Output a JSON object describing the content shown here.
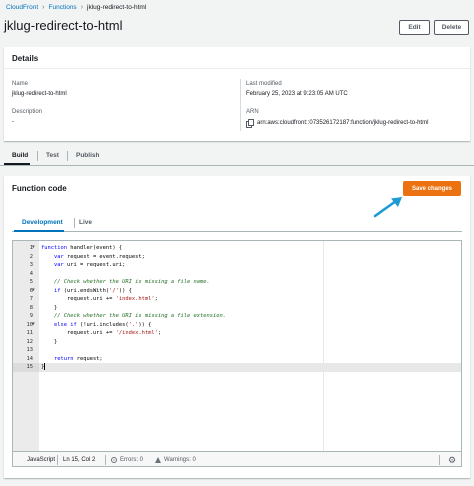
{
  "breadcrumb": {
    "items": [
      "CloudFront",
      "Functions",
      "jklug-redirect-to-html"
    ]
  },
  "page_title": "jklug-redirect-to-html",
  "header_buttons": {
    "edit": "Edit",
    "delete": "Delete"
  },
  "details": {
    "title": "Details",
    "name_label": "Name",
    "name_value": "jklug-redirect-to-html",
    "description_label": "Description",
    "description_value": "-",
    "last_modified_label": "Last modified",
    "last_modified_value": "February 25, 2023 at 9:23:05 AM UTC",
    "arn_label": "ARN",
    "arn_value": "arn:aws:cloudfront::073526172187:function/jklug-redirect-to-html"
  },
  "tabs": [
    "Build",
    "Test",
    "Publish"
  ],
  "function_code": {
    "title": "Function code",
    "save_label": "Save changes",
    "subtabs": [
      "Development",
      "Live"
    ]
  },
  "editor": {
    "lines": [
      {
        "n": "1",
        "fold": true,
        "html": "<span class='kw'>function</span> handler(event) {"
      },
      {
        "n": "2",
        "fold": false,
        "html": "    <span class='kw'>var</span> request = event.request;"
      },
      {
        "n": "3",
        "fold": false,
        "html": "    <span class='kw'>var</span> uri = request.uri;"
      },
      {
        "n": "4",
        "fold": false,
        "html": ""
      },
      {
        "n": "5",
        "fold": false,
        "html": "    <span class='cm'>// Check whether the URI is missing a file name.</span>"
      },
      {
        "n": "6",
        "fold": true,
        "html": "    <span class='kw'>if</span> (uri.endsWith(<span class='str'>'/'</span>)) {"
      },
      {
        "n": "7",
        "fold": false,
        "html": "        request.uri += <span class='str'>'index.html'</span>;"
      },
      {
        "n": "8",
        "fold": false,
        "html": "    }"
      },
      {
        "n": "9",
        "fold": false,
        "html": "    <span class='cm'>// Check whether the URI is missing a file extension.</span>"
      },
      {
        "n": "10",
        "fold": true,
        "html": "    <span class='kw'>else if</span> (!uri.includes(<span class='str'>'.'</span>)) {"
      },
      {
        "n": "11",
        "fold": false,
        "html": "        request.uri += <span class='str'>'/index.html'</span>;"
      },
      {
        "n": "12",
        "fold": false,
        "html": "    }"
      },
      {
        "n": "13",
        "fold": false,
        "html": ""
      },
      {
        "n": "14",
        "fold": false,
        "html": "    <span class='kw'>return</span> request;"
      },
      {
        "n": "15",
        "fold": false,
        "html": "}",
        "current": true
      }
    ]
  },
  "statusbar": {
    "language": "JavaScript",
    "position": "Ln 15, Col 2",
    "errors": "Errors: 0",
    "warnings": "Warnings: 0"
  },
  "colors": {
    "accent": "#0073bb",
    "primary_button": "#ec7211",
    "annotation_arrow": "#1f9bd3"
  }
}
